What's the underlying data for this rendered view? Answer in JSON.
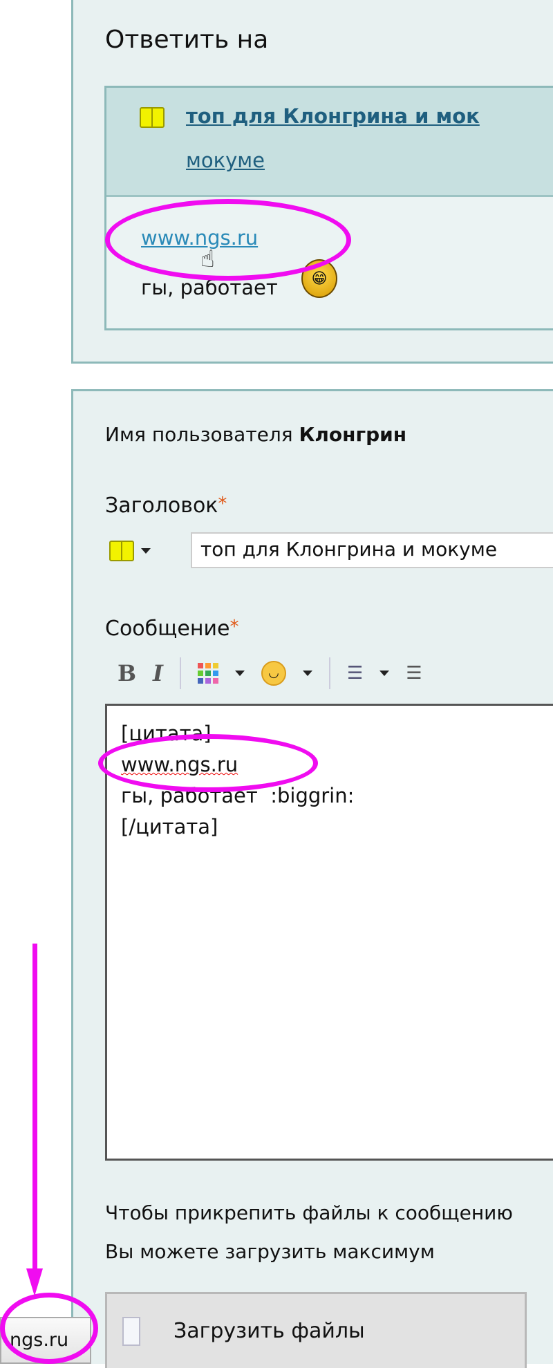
{
  "reply_panel": {
    "heading": "Ответить на",
    "quote": {
      "title_link": "топ для Клонгрина и мокуме",
      "title_visible": "топ для Клонгрина и мок",
      "author_link": "мокуме",
      "body_link": "www.ngs.ru",
      "body_text": "гы, работает",
      "smiley": "biggrin-icon"
    }
  },
  "form": {
    "username_label": "Имя пользователя",
    "username": "Клонгрин",
    "title_label": "Заголовок",
    "required_mark": "*",
    "title_value": "топ для Клонгрина и мокуме",
    "message_label": "Сообщение",
    "toolbar": {
      "bold": "B",
      "italic": "I"
    },
    "message_lines": [
      "[цитата]",
      "www.ngs.ru",
      "гы, работает  :biggrin:",
      "[/цитата]"
    ],
    "attach_text_1": "Чтобы прикрепить файлы к сообщению",
    "attach_text_2": "Вы можете загрузить максимум",
    "upload_button": "Загрузить файлы"
  },
  "status_bar": {
    "url": "ngs.ru"
  },
  "annotation_color": "#f00cf0"
}
